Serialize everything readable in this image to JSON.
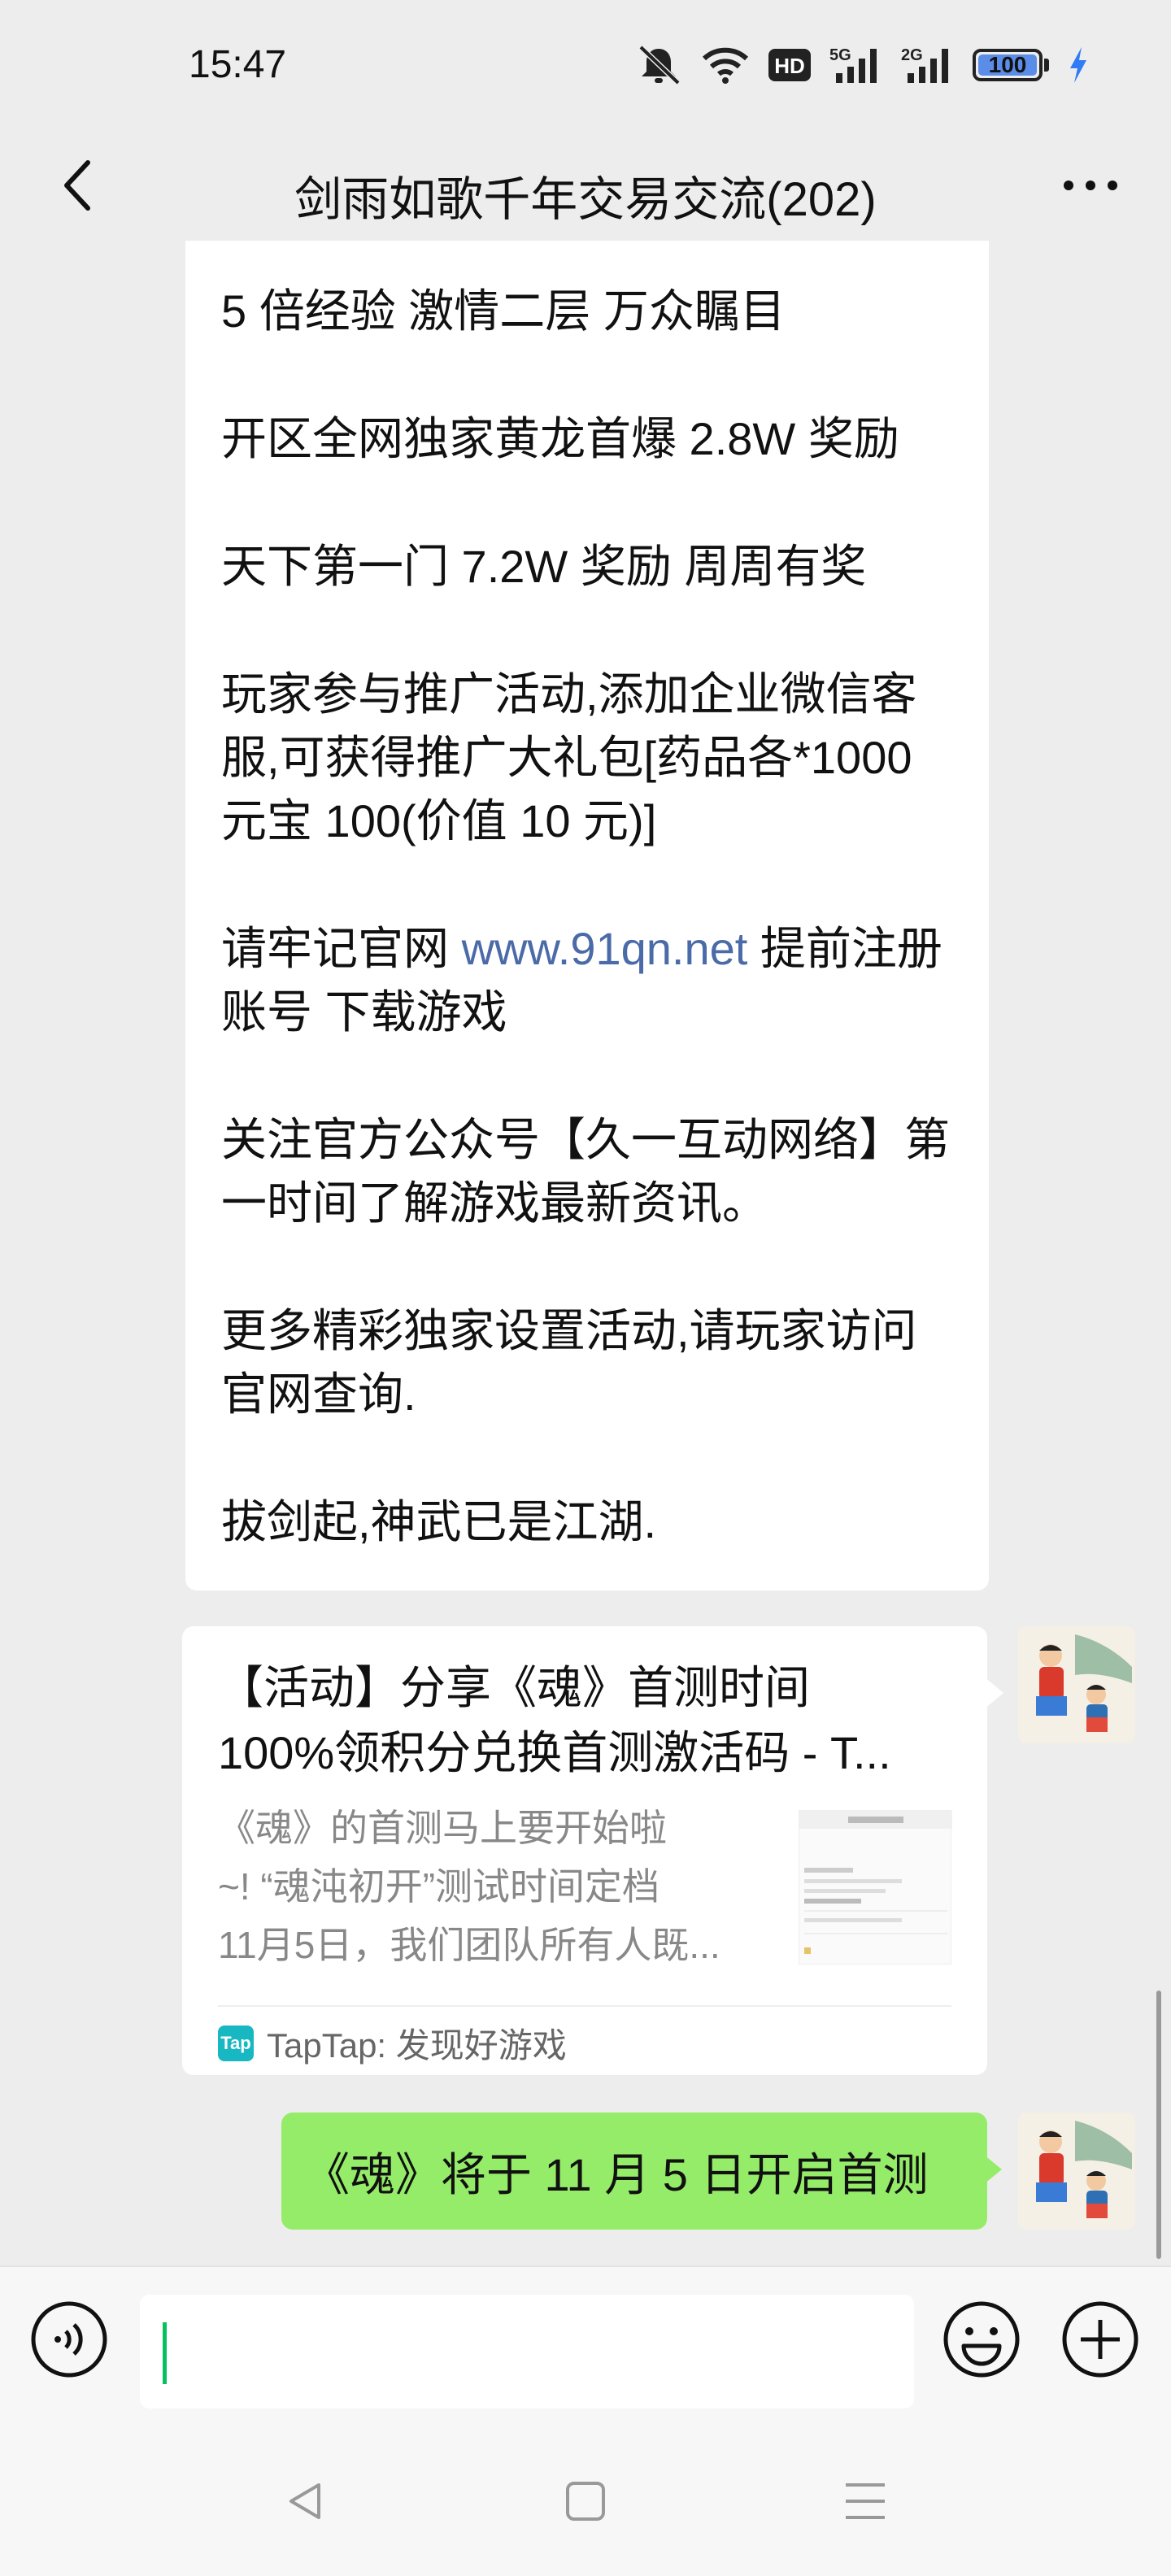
{
  "status_bar": {
    "time": "15:47",
    "battery": "100",
    "battery_level": 1.0,
    "icons": [
      "mute-bell-icon",
      "wifi-icon",
      "hd-icon",
      "5g-signal-icon",
      "2g-signal-icon",
      "battery-icon",
      "charging-bolt-icon"
    ],
    "hd_label": "HD",
    "net1_label": "5G",
    "net2_label": "2G"
  },
  "header": {
    "title": "剑雨如歌千年交易交流(202)",
    "back_icon": "chevron-left-icon",
    "more_icon": "more-dots-icon"
  },
  "messages": {
    "text_message": {
      "lines": [
        "5 倍经验 激情二层 万众瞩目",
        "开区全网独家黄龙首爆 2.8W 奖励",
        "天下第一门 7.2W 奖励 周周有奖",
        "玩家参与推广活动,添加企业微信客服,可获得推广大礼包[药品各*1000 元宝 100(价值 10 元)]",
        "关注官方公众号【久一互动网络】第一时间了解游戏最新资讯。",
        "更多精彩独家设置活动,请玩家访问官网查询.",
        "拔剑起,神武已是江湖."
      ],
      "website_prefix": "请牢记官网 ",
      "website_link": "www.91qn.net",
      "website_suffix": " 提前注册账号 下载游戏"
    },
    "link_card": {
      "title_line1": "【活动】分享《魂》首测时间",
      "title_line2": "100%领积分兑换首测激活码 - T...",
      "desc_line1": "《魂》的首测马上要开始啦",
      "desc_line2": "~! “魂沌初开”测试时间定档",
      "desc_line3": "11月5日，我们团队所有人既...",
      "source_icon_label": "Tap",
      "source": "TapTap: 发现好游戏"
    },
    "sent_message": {
      "text": "《魂》将于 11 月 5 日开启首测"
    }
  },
  "input_bar": {
    "value": "",
    "voice_icon": "voice-icon",
    "emoji_icon": "emoji-icon",
    "plus_icon": "plus-icon"
  },
  "nav_bar": {
    "icons": [
      "nav-back-icon",
      "nav-home-icon",
      "nav-menu-icon"
    ]
  },
  "colors": {
    "background": "#ededed",
    "bubble_received": "#ffffff",
    "bubble_sent": "#95ec69",
    "link": "#4a6aa8",
    "caret": "#07c160"
  }
}
